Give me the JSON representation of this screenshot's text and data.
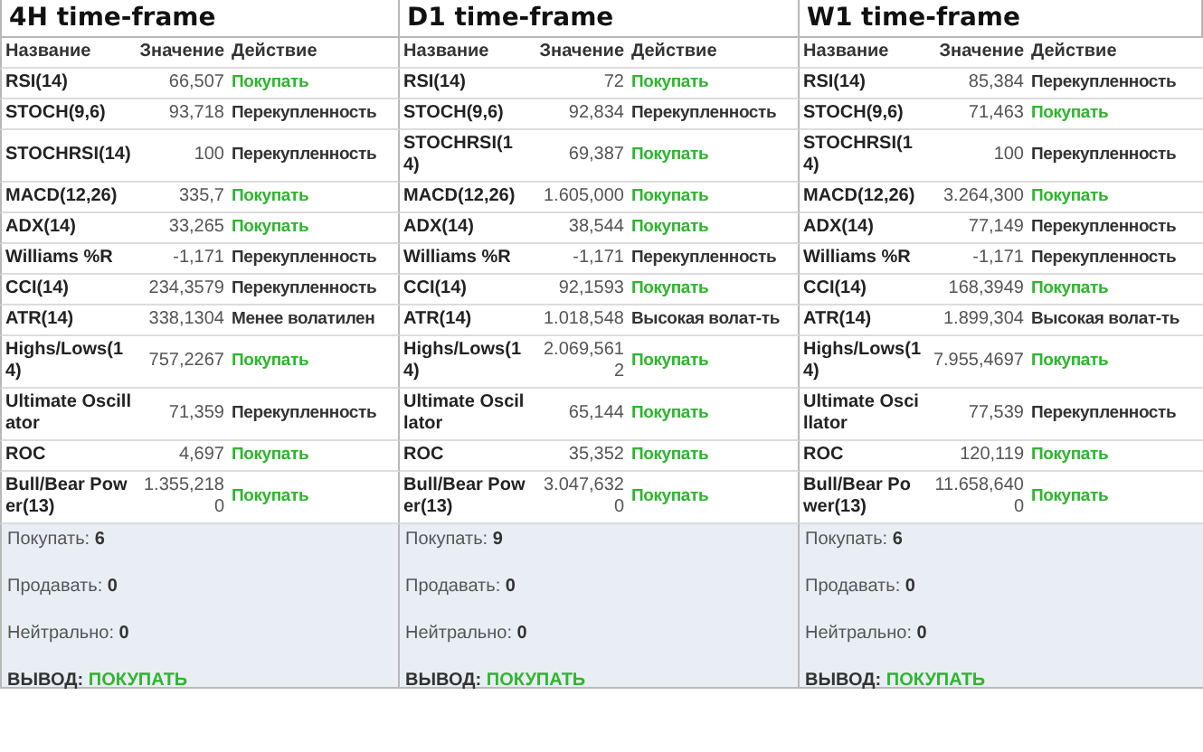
{
  "panels": [
    {
      "title": "4H time-frame",
      "columns": [
        "Название",
        "Значение",
        "Действие"
      ],
      "rows": [
        {
          "name": "RSI(14)",
          "value": "66,507",
          "action": "Покупать",
          "kind": "buy"
        },
        {
          "name": "STOCH(9,6)",
          "value": "93,718",
          "action": "Перекупленность",
          "kind": "other"
        },
        {
          "name": "STOCHRSI(14)",
          "value": "100",
          "action": "Перекупленность",
          "kind": "other"
        },
        {
          "name": "MACD(12,26)",
          "value": "335,7",
          "action": "Покупать",
          "kind": "buy"
        },
        {
          "name": "ADX(14)",
          "value": "33,265",
          "action": "Покупать",
          "kind": "buy"
        },
        {
          "name": "Williams %R",
          "value": "-1,171",
          "action": "Перекупленность",
          "kind": "other"
        },
        {
          "name": "CCI(14)",
          "value": "234,3579",
          "action": "Перекупленность",
          "kind": "other"
        },
        {
          "name": "ATR(14)",
          "value": "338,1304",
          "action": "Менее волатилен",
          "kind": "other"
        },
        {
          "name": "Highs/Lows(14)",
          "value": "757,2267",
          "action": "Покупать",
          "kind": "buy"
        },
        {
          "name": "Ultimate Oscillator",
          "value": "71,359",
          "action": "Перекупленность",
          "kind": "other"
        },
        {
          "name": "ROC",
          "value": "4,697",
          "action": "Покупать",
          "kind": "buy"
        },
        {
          "name": "Bull/Bear Power(13)",
          "value": "1.355,2180",
          "action": "Покупать",
          "kind": "buy"
        }
      ],
      "summary": [
        {
          "kind": "count",
          "label": "Покупать:",
          "value": "6"
        },
        {
          "kind": "count",
          "label": "Продавать:",
          "value": "0"
        },
        {
          "kind": "count",
          "label": "Нейтрально:",
          "value": "0"
        },
        {
          "kind": "verdict",
          "label": "ВЫВОД:",
          "value": "ПОКУПАТЬ"
        }
      ]
    },
    {
      "title": "D1 time-frame",
      "columns": [
        "Название",
        "Значение",
        "Действие"
      ],
      "rows": [
        {
          "name": "RSI(14)",
          "value": "72",
          "action": "Покупать",
          "kind": "buy"
        },
        {
          "name": "STOCH(9,6)",
          "value": "92,834",
          "action": "Перекупленность",
          "kind": "other"
        },
        {
          "name": "STOCHRSI(14)",
          "value": "69,387",
          "action": "Покупать",
          "kind": "buy"
        },
        {
          "name": "MACD(12,26)",
          "value": "1.605,000",
          "action": "Покупать",
          "kind": "buy"
        },
        {
          "name": "ADX(14)",
          "value": "38,544",
          "action": "Покупать",
          "kind": "buy"
        },
        {
          "name": "Williams %R",
          "value": "-1,171",
          "action": "Перекупленность",
          "kind": "other"
        },
        {
          "name": "CCI(14)",
          "value": "92,1593",
          "action": "Покупать",
          "kind": "buy"
        },
        {
          "name": "ATR(14)",
          "value": "1.018,548",
          "action": "Высокая волат-ть",
          "kind": "other"
        },
        {
          "name": "Highs/Lows(14)",
          "value": "2.069,5612",
          "action": "Покупать",
          "kind": "buy"
        },
        {
          "name": "Ultimate Oscillator",
          "value": "65,144",
          "action": "Покупать",
          "kind": "buy"
        },
        {
          "name": "ROC",
          "value": "35,352",
          "action": "Покупать",
          "kind": "buy"
        },
        {
          "name": "Bull/Bear Power(13)",
          "value": "3.047,6320",
          "action": "Покупать",
          "kind": "buy"
        }
      ],
      "summary": [
        {
          "kind": "count",
          "label": "Покупать:",
          "value": "9"
        },
        {
          "kind": "count",
          "label": "Продавать:",
          "value": "0"
        },
        {
          "kind": "count",
          "label": "Нейтрально:",
          "value": "0"
        },
        {
          "kind": "verdict",
          "label": "ВЫВОД:",
          "value": "ПОКУПАТЬ"
        }
      ]
    },
    {
      "title": "W1 time-frame",
      "columns": [
        "Название",
        "Значение",
        "Действие"
      ],
      "rows": [
        {
          "name": "RSI(14)",
          "value": "85,384",
          "action": "Перекупленность",
          "kind": "other"
        },
        {
          "name": "STOCH(9,6)",
          "value": "71,463",
          "action": "Покупать",
          "kind": "buy"
        },
        {
          "name": "STOCHRSI(14)",
          "value": "100",
          "action": "Перекупленность",
          "kind": "other"
        },
        {
          "name": "MACD(12,26)",
          "value": "3.264,300",
          "action": "Покупать",
          "kind": "buy"
        },
        {
          "name": "ADX(14)",
          "value": "77,149",
          "action": "Перекупленность",
          "kind": "other"
        },
        {
          "name": "Williams %R",
          "value": "-1,171",
          "action": "Перекупленность",
          "kind": "other"
        },
        {
          "name": "CCI(14)",
          "value": "168,3949",
          "action": "Покупать",
          "kind": "buy"
        },
        {
          "name": "ATR(14)",
          "value": "1.899,304",
          "action": "Высокая волат-ть",
          "kind": "other"
        },
        {
          "name": "Highs/Lows(14)",
          "value": "7.955,4697",
          "action": "Покупать",
          "kind": "buy"
        },
        {
          "name": "Ultimate Oscillator",
          "value": "77,539",
          "action": "Перекупленность",
          "kind": "other"
        },
        {
          "name": "ROC",
          "value": "120,119",
          "action": "Покупать",
          "kind": "buy"
        },
        {
          "name": "Bull/Bear Power(13)",
          "value": "11.658,6400",
          "action": "Покупать",
          "kind": "buy"
        }
      ],
      "summary": [
        {
          "kind": "count",
          "label": "Покупать:",
          "value": "6"
        },
        {
          "kind": "count",
          "label": "Продавать:",
          "value": "0"
        },
        {
          "kind": "count",
          "label": "Нейтрально:",
          "value": "0"
        },
        {
          "kind": "verdict",
          "label": "ВЫВОД:",
          "value": "ПОКУПАТЬ"
        }
      ]
    }
  ]
}
